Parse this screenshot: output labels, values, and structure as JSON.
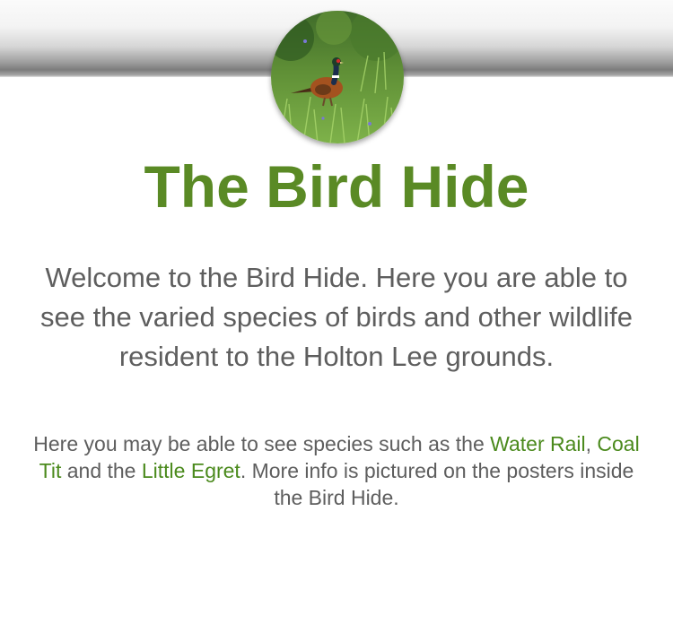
{
  "page": {
    "title": "The Bird Hide",
    "intro": "Welcome to the Bird Hide. Here you are able to see the varied species of birds and other wildlife resident to the Holton Lee grounds.",
    "details": {
      "prefix": "Here you may be able to see species such as the ",
      "link_water_rail": "Water Rail",
      "sep1": ", ",
      "link_coal_tit": "Coal Tit",
      "sep2": " and the ",
      "link_little_egret": "Little Egret",
      "suffix": ". More info is pictured on the posters inside the Bird Hide."
    }
  },
  "header_image": {
    "subject": "pheasant in grass"
  },
  "colors": {
    "title_green": "#5a8a25",
    "link_green": "#4b8a1d",
    "body_text": "#5e5e5e"
  }
}
